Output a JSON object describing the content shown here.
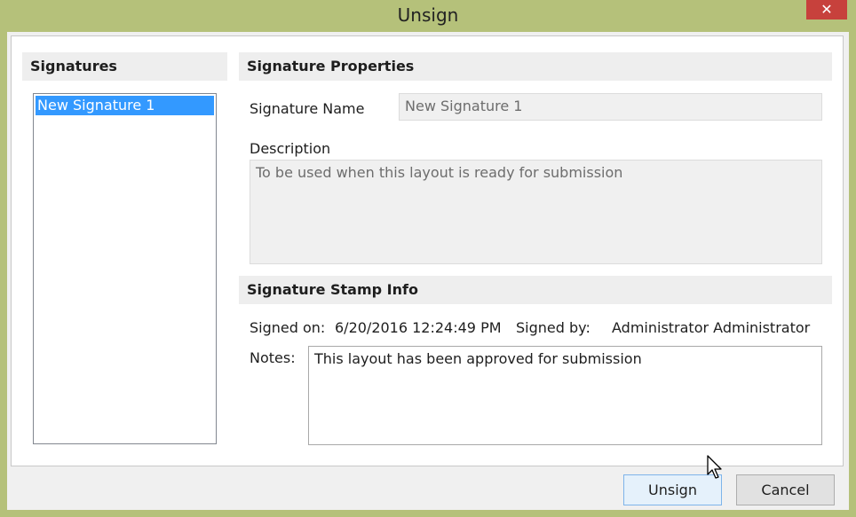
{
  "window": {
    "title": "Unsign",
    "close_glyph": "✕"
  },
  "signatures": {
    "header": "Signatures",
    "items": [
      {
        "label": "New Signature 1",
        "selected": true
      }
    ]
  },
  "properties": {
    "header": "Signature Properties",
    "name_label": "Signature Name",
    "name_value": "New Signature 1",
    "description_label": "Description",
    "description_value": "To be used when this layout is ready for submission"
  },
  "stamp": {
    "header": "Signature Stamp Info",
    "signed_on_label": "Signed on:",
    "signed_on_value": "6/20/2016 12:24:49 PM",
    "signed_by_label": "Signed by:",
    "signed_by_value": "Administrator Administrator",
    "notes_label": "Notes:",
    "notes_value": "This layout has been approved for submission"
  },
  "buttons": {
    "unsign": "Unsign",
    "cancel": "Cancel"
  },
  "colors": {
    "window_frame": "#b5c17a",
    "close_button": "#c7413c",
    "selection": "#3399ff"
  }
}
